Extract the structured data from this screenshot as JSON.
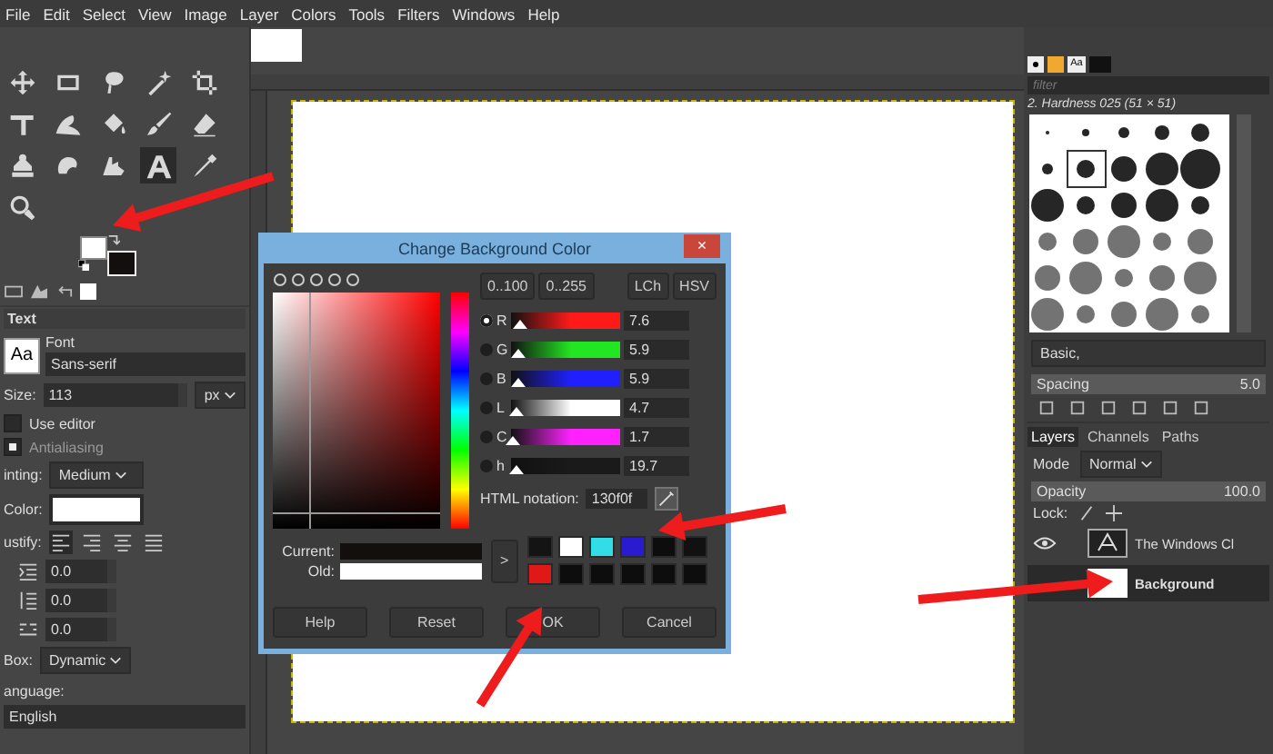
{
  "menu": [
    "File",
    "Edit",
    "Select",
    "View",
    "Image",
    "Layer",
    "Colors",
    "Tools",
    "Filters",
    "Windows",
    "Help"
  ],
  "toolbox": {
    "tools": [
      {
        "kind": "move",
        "selected": false
      },
      {
        "kind": "rect",
        "selected": false
      },
      {
        "kind": "lasso",
        "selected": false
      },
      {
        "kind": "wand",
        "selected": false
      },
      {
        "kind": "crop",
        "selected": false
      },
      {
        "kind": "transform",
        "selected": false
      },
      {
        "kind": "warp",
        "selected": false
      },
      {
        "kind": "bucket",
        "selected": false
      },
      {
        "kind": "brush",
        "selected": false
      },
      {
        "kind": "eraser",
        "selected": false
      },
      {
        "kind": "clone",
        "selected": false
      },
      {
        "kind": "smudge",
        "selected": false
      },
      {
        "kind": "paths",
        "selected": false
      },
      {
        "kind": "text",
        "selected": true
      },
      {
        "kind": "picker",
        "selected": false
      },
      {
        "kind": "zoom",
        "selected": false
      }
    ],
    "background_selected": true
  },
  "tool_options": {
    "title": "Text",
    "font_preview": "Aa",
    "font_label": "Font",
    "font": "Sans-serif",
    "size_label": "Size:",
    "size": "113",
    "unit": "px",
    "use_editor": {
      "label": "Use editor",
      "checked": false
    },
    "antialiasing": {
      "label": "Antialiasing",
      "checked": true
    },
    "hinting_label": "inting:",
    "hinting": "Medium",
    "color_label": "Color:",
    "justify_label": "ustify:",
    "justify": [
      {
        "selected": true
      },
      {
        "selected": false
      },
      {
        "selected": false
      },
      {
        "selected": false
      }
    ],
    "spacing": [
      "0.0",
      "0.0",
      "0.0"
    ],
    "box_label": "Box:",
    "box": "Dynamic",
    "language_label": "anguage:",
    "language": "English"
  },
  "dialog": {
    "title": "Change Background Color",
    "close": "×",
    "ranges": [
      "0..100",
      "0..255"
    ],
    "models": [
      "LCh",
      "HSV"
    ],
    "channels": [
      {
        "name": "R",
        "value": "7.6",
        "level": 0.08,
        "color": "#ff1a1a",
        "selected": true
      },
      {
        "name": "G",
        "value": "5.9",
        "level": 0.06,
        "color": "#22e622",
        "selected": false
      },
      {
        "name": "B",
        "value": "5.9",
        "level": 0.06,
        "color": "#2020ff",
        "selected": false
      },
      {
        "name": "L",
        "value": "4.7",
        "level": 0.05,
        "color": "#ffffff",
        "selected": false
      },
      {
        "name": "C",
        "value": "1.7",
        "level": 0.02,
        "color": "#ff22ff",
        "selected": false
      },
      {
        "name": "h",
        "value": "19.7",
        "level": 0.05,
        "color": "#1a1a1a",
        "selected": false
      }
    ],
    "html_label": "HTML notation:",
    "html": "130f0f",
    "current_label": "Current:",
    "old_label": "Old:",
    "history_button": ">",
    "swatches": [
      {
        "color": "#141414"
      },
      {
        "color": "#ffffff"
      },
      {
        "color": "#33dde8"
      },
      {
        "color": "#2a1ad0"
      },
      {
        "color": "#0d0d0d"
      },
      {
        "color": "#111111"
      },
      {
        "color": "#e01818"
      },
      {
        "color": "#0d0d0d"
      },
      {
        "color": "#0d0d0d"
      },
      {
        "color": "#0d0d0d"
      },
      {
        "color": "#0d0d0d"
      },
      {
        "color": "#0d0d0d"
      }
    ],
    "buttons": [
      "Help",
      "Reset",
      "OK",
      "Cancel"
    ]
  },
  "brushes": {
    "font_tab": "Aa",
    "filter_placeholder": "filter",
    "brush_name": "2. Hardness 025 (51 × 51)",
    "preset": "Basic,",
    "spacing": {
      "label": "Spacing",
      "value": "5.0",
      "level": 1
    }
  },
  "layers_panel": {
    "tabs": [
      {
        "label": "Layers",
        "selected": true
      },
      {
        "label": "Channels",
        "selected": false
      },
      {
        "label": "Paths",
        "selected": false
      }
    ],
    "mode_label": "Mode",
    "mode": "Normal",
    "opacity": {
      "label": "Opacity",
      "value": "100.0",
      "level": 1
    },
    "lock_label": "Lock:",
    "layers": [
      {
        "name": "The Windows Cl",
        "kind": "text",
        "visible": true,
        "selected": false
      },
      {
        "name": "Background",
        "kind": "image",
        "visible": false,
        "selected": true
      }
    ]
  }
}
